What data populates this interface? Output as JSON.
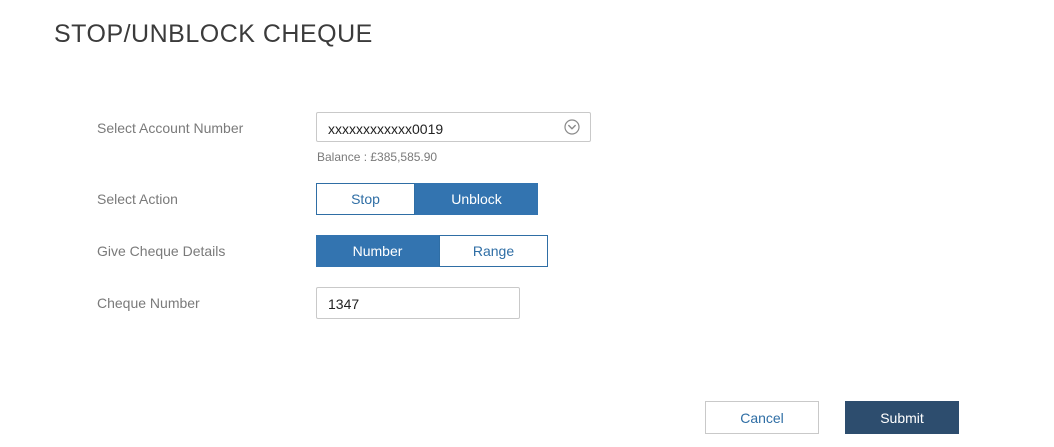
{
  "page": {
    "title": "STOP/UNBLOCK CHEQUE"
  },
  "account": {
    "label": "Select Account Number",
    "selected": "xxxxxxxxxxxx0019",
    "balance": "Balance : £385,585.90",
    "dropdown_icon": "chevron-down-circle-icon"
  },
  "action": {
    "label": "Select Action",
    "options": [
      "Stop",
      "Unblock"
    ],
    "selected": "Unblock"
  },
  "details": {
    "label": "Give Cheque Details",
    "options": [
      "Number",
      "Range"
    ],
    "selected": "Number"
  },
  "cheque": {
    "label": "Cheque Number",
    "value": "1347"
  },
  "buttons": {
    "cancel": "Cancel",
    "submit": "Submit"
  },
  "colors": {
    "accent": "#3374b0",
    "submit": "#2d4d6e",
    "label": "#7a7a7a"
  }
}
